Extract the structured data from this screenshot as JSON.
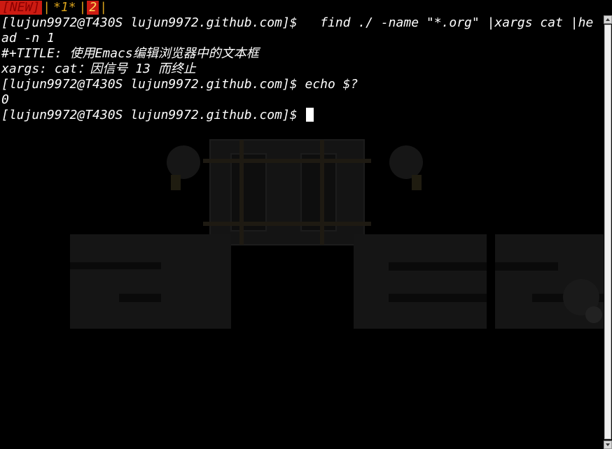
{
  "tabs": [
    {
      "label": "[NEW]",
      "style": "active"
    },
    {
      "label": "*1*",
      "style": "plain"
    },
    {
      "label": "2",
      "style": "numbered"
    }
  ],
  "separator": "|",
  "terminal": {
    "lines": [
      "[lujun9972@T430S lujun9972.github.com]$   find ./ -name \"*.org\" |xargs cat |he",
      "ad -n 1",
      "#+TITLE: 使用Emacs编辑浏览器中的文本框",
      "xargs: cat：因信号 13 而终止",
      "[lujun9972@T430S lujun9972.github.com]$ echo $?",
      "0"
    ],
    "prompt": "[lujun9972@T430S lujun9972.github.com]$ "
  },
  "colors": {
    "background": "#000000",
    "text": "#ffffff",
    "tab_active_bg": "#cc1b12",
    "tab_plain": "#d9a21b",
    "tab_number": "#ffd95a"
  },
  "icons": {
    "scroll_up": "up-arrow-icon",
    "scroll_down": "down-arrow-icon"
  }
}
